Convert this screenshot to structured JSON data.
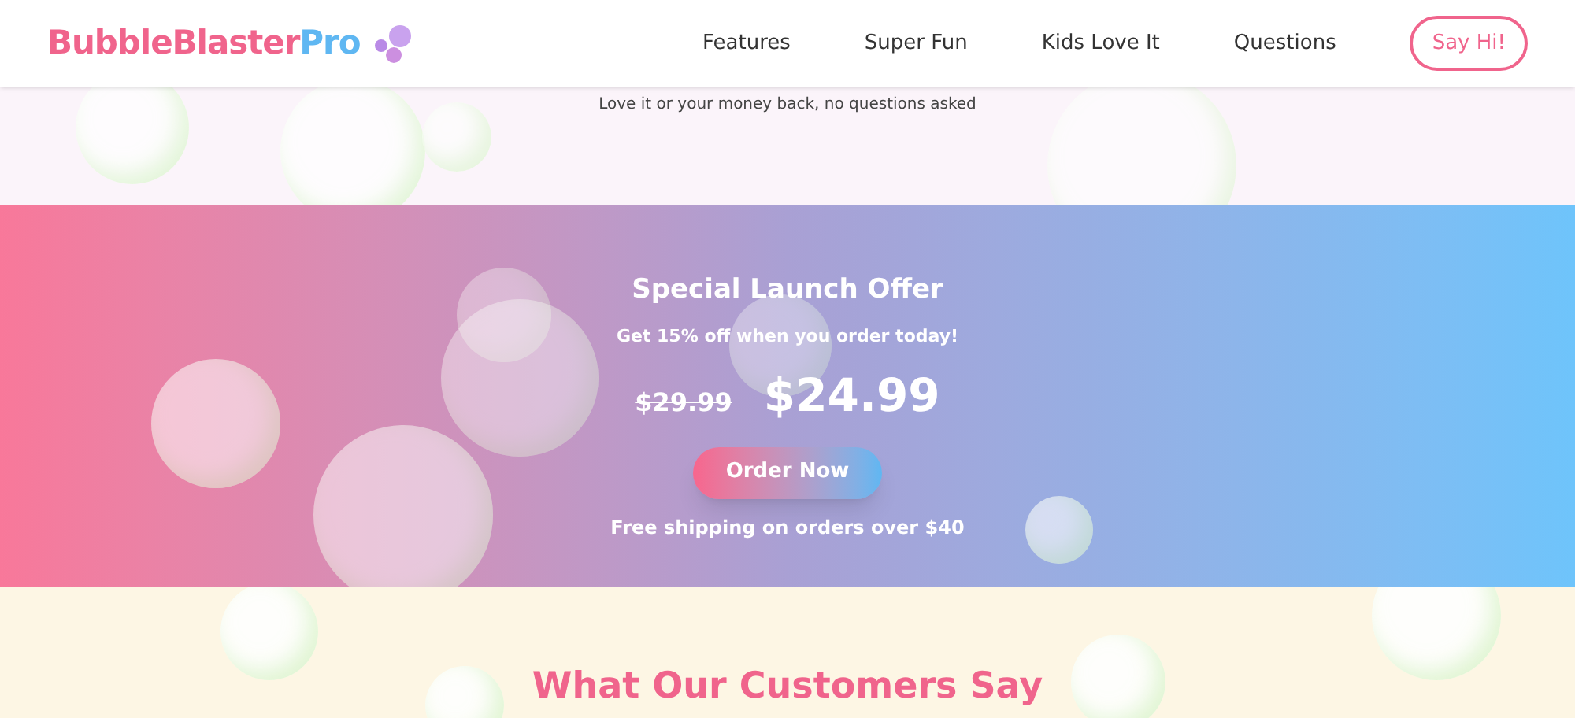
{
  "header": {
    "logo": {
      "main": "BubbleBlaster",
      "accent": "Pro"
    },
    "nav": [
      {
        "label": "Features"
      },
      {
        "label": "Super Fun"
      },
      {
        "label": "Kids Love It"
      },
      {
        "label": "Questions"
      }
    ],
    "cta": "Say Hi!"
  },
  "guarantee": "Love it or your money back, no questions asked",
  "offer": {
    "title": "Special Launch Offer",
    "subtitle": "Get 15% off when you order today!",
    "old_price": "$29.99",
    "price": "$24.99",
    "button": "Order Now",
    "note": "Free shipping on orders over $40"
  },
  "testimonials": {
    "title": "What Our Customers Say"
  }
}
